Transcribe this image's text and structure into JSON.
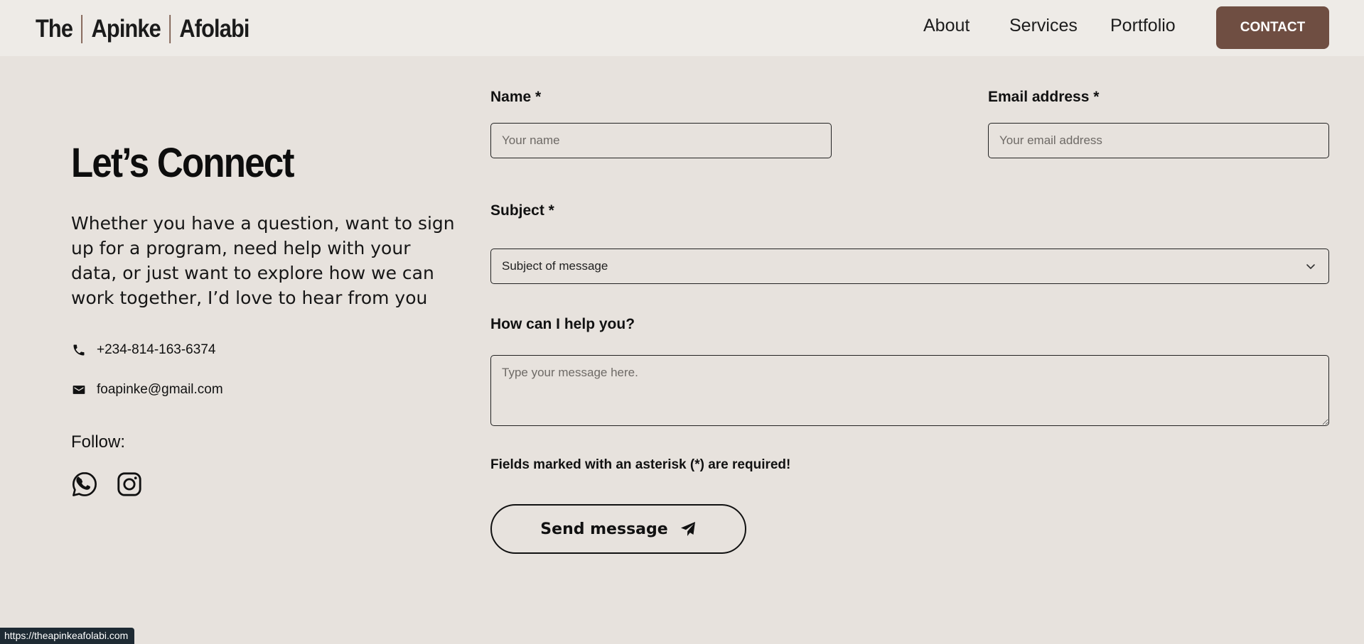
{
  "header": {
    "logo_parts": [
      "The",
      "Apinke",
      "Afolabi"
    ],
    "nav": {
      "about": "About",
      "services": "Services",
      "portfolio": "Portfolio"
    },
    "contact_label": "CONTACT"
  },
  "intro": {
    "title": "Let’s Connect",
    "text": "Whether you have a question, want to sign up for a program, need help with your data, or just want to explore how we can work together, I’d love to hear from you",
    "phone": "+234-814-163-6374",
    "email": "foapinke@gmail.com",
    "follow_label": "Follow:"
  },
  "icons": {
    "phone": "phone-icon",
    "email": "mail-icon",
    "whatsapp": "whatsapp-icon",
    "instagram": "instagram-icon",
    "chevron": "chevron-down-icon",
    "send": "paper-plane-icon"
  },
  "form": {
    "name_label": "Name *",
    "name_placeholder": "Your name",
    "email_label": "Email address *",
    "email_placeholder": "Your email address",
    "subject_label": "Subject *",
    "subject_value": "Subject of message",
    "help_label": "How can I help you?",
    "help_placeholder": "Type your message here.",
    "required_note": "Fields marked with an asterisk (*) are required!",
    "send_label": "Send message"
  },
  "status_bar": {
    "url": "https://theapinkeafolabi.com"
  },
  "colors": {
    "page_bg": "#e7e2dd",
    "header_bg": "#eeebe7",
    "accent": "#6f4e42",
    "text": "#111111"
  }
}
